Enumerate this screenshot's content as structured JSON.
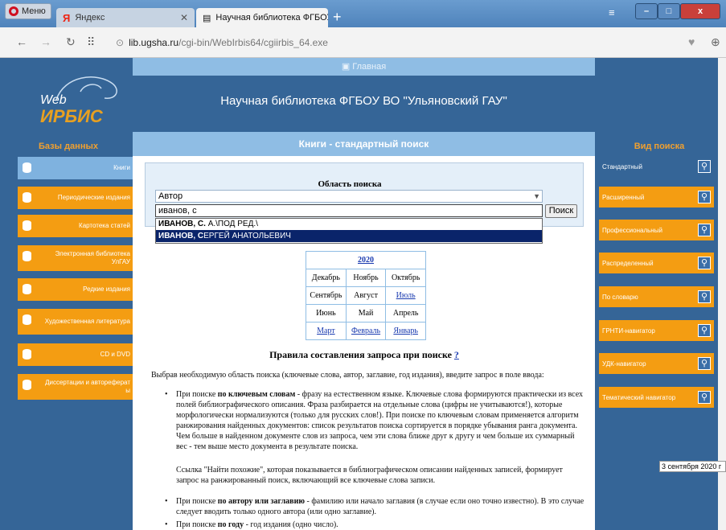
{
  "browser": {
    "menu_label": "Меню",
    "tabs": [
      {
        "label": "Яндекс",
        "brand": "Я"
      },
      {
        "label": "Научная библиотека ФГБОУ"
      }
    ],
    "new_tab": "+",
    "url_domain": "lib.ugsha.ru",
    "url_path": "/cgi-bin/WebIrbis64/cgiirbis_64.exe"
  },
  "site": {
    "top_menu": "Главная",
    "logo_web": "Web",
    "logo_irbis": "ИРБИС",
    "title": "Научная библиотека ФГБОУ ВО \"Ульяновский ГАУ\""
  },
  "left": {
    "heading": "Базы данных",
    "items": [
      {
        "label": "Книги"
      },
      {
        "label": "Периодические издания"
      },
      {
        "label": "Картотека статей"
      },
      {
        "label": "Электронная библиотека УлГАУ"
      },
      {
        "label": "Редкие издания"
      },
      {
        "label": "Художественная литература"
      },
      {
        "label": "CD и DVD"
      },
      {
        "label": "Диссертации и автореферат ы"
      }
    ]
  },
  "right": {
    "heading": "Вид поиска",
    "items": [
      {
        "label": "Стандартный"
      },
      {
        "label": "Расширенный"
      },
      {
        "label": "Профессиональный"
      },
      {
        "label": "Распределенный"
      },
      {
        "label": "По словарю"
      },
      {
        "label": "ГРНТИ-навигатор"
      },
      {
        "label": "УДК-навигатор"
      },
      {
        "label": "Тематический навигатор"
      }
    ]
  },
  "search": {
    "header": "Книги - стандартный поиск",
    "area_label": "Область поиска",
    "area_value": "Автор",
    "query": "иванов, с",
    "button": "Поиск",
    "suggestions": [
      {
        "bold": "ИВАНОВ, С.",
        "rest": " А.\\ПОД РЕД.\\"
      },
      {
        "bold": "ИВАНОВ, С",
        "rest": "ЕРГЕЙ АНАТОЛЬЕВИЧ"
      }
    ]
  },
  "calendar": {
    "year": "2020",
    "rows": [
      [
        "Декабрь",
        "Ноябрь",
        "Октябрь"
      ],
      [
        "Сентябрь",
        "Август",
        "Июль"
      ],
      [
        "Июнь",
        "Май",
        "Апрель"
      ],
      [
        "Март",
        "Февраль",
        "Январь"
      ]
    ]
  },
  "rules": {
    "title": "Правила составления запроса при поиске",
    "help": "?",
    "intro": "Выбрав необходимую область поиска (ключевые слова, автор, заглавие, год издания), введите запрос в поле ввода:",
    "b1_pre": "При поиске ",
    "b1_bold": "по ключевым словам",
    "b1_text": " - фразу на естественном языке. Ключевые слова формируются практически из всех полей библиографического описания. Фраза разбирается на отдельные слова (цифры не учитываются!), которые морфологически нормализуются (только для русских слов!). При поиске по ключевым словам применяется алгоритм ранжирования найденных документов: список результатов поиска сортируется в порядке убывания ранга документа. Чем больше в найденном документе слов из запроса, чем эти слова ближе друг к другу и чем больше их суммарный вес - тем выше место документа в результате поиска.",
    "b1_note": "Ссылка \"Найти похожие\", которая показывается в библиографическом описании найденных записей, формирует запрос на ранжированный поиск, включающий все ключевые слова записи.",
    "b2_pre": "При поиске ",
    "b2_bold": "по автору или заглавию",
    "b2_text": " - фамилию или начало заглавия (в случае если оно точно известно). В это случае следует вводить только одного автора (или одно заглавие).",
    "b3_pre": "При поиске ",
    "b3_bold": "по году",
    "b3_text": " - год издания (одно число)."
  },
  "taskbar_date": "3 сентября 2020 г"
}
